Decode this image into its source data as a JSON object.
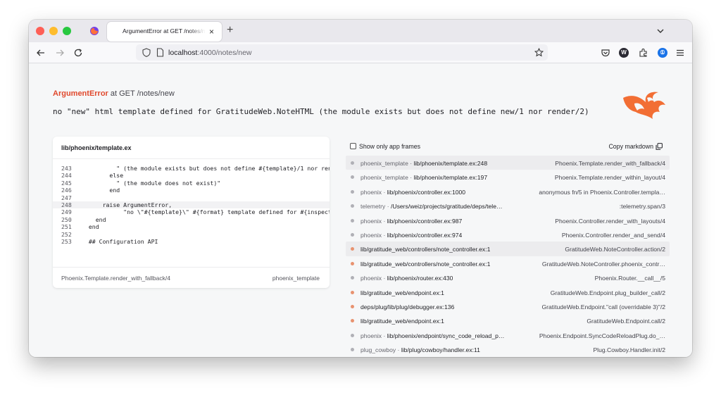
{
  "browser": {
    "tab_title": "ArgumentError at GET /notes/new",
    "tab_close": "×",
    "new_tab": "+",
    "url_host": "localhost",
    "url_path": ":4000/notes/new",
    "ext_w": "W",
    "ext_pw": "①"
  },
  "error": {
    "type": "ArgumentError",
    "location": " at GET /notes/new",
    "message": "no \"new\" html template defined for GratitudeWeb.NoteHTML  (the module exists but does not define new/1 nor render/2)"
  },
  "code_panel": {
    "file": "lib/phoenix/template.ex",
    "highlighted_line": 248,
    "lines": [
      {
        "num": "243",
        "code": "          \" (the module exists but does not define #{template}/1 nor render/2)\""
      },
      {
        "num": "244",
        "code": "        else"
      },
      {
        "num": "245",
        "code": "          \" (the module does not exist)\""
      },
      {
        "num": "246",
        "code": "        end"
      },
      {
        "num": "247",
        "code": ""
      },
      {
        "num": "248",
        "code": "      raise ArgumentError,"
      },
      {
        "num": "249",
        "code": "            \"no \\\"#{template}\\\" #{format} template defined for #{inspect(module)}\""
      },
      {
        "num": "250",
        "code": "    end"
      },
      {
        "num": "251",
        "code": "  end"
      },
      {
        "num": "252",
        "code": ""
      },
      {
        "num": "253",
        "code": "  ## Configuration API"
      }
    ],
    "footer_function": "Phoenix.Template.render_with_fallback/4",
    "footer_app": "phoenix_template"
  },
  "stacktrace": {
    "show_only_label": "Show only app frames",
    "copy_label": "Copy markdown",
    "frames": [
      {
        "app": "phoenix_template · ",
        "file": "lib/phoenix/template.ex:248",
        "fn": "Phoenix.Template.render_with_fallback/4",
        "kind": "lib",
        "active": true
      },
      {
        "app": "phoenix_template · ",
        "file": "lib/phoenix/template.ex:197",
        "fn": "Phoenix.Template.render_within_layout/4",
        "kind": "lib",
        "active": false
      },
      {
        "app": "phoenix · ",
        "file": "lib/phoenix/controller.ex:1000",
        "fn": "anonymous fn/5 in Phoenix.Controller.templa…",
        "kind": "lib",
        "active": false
      },
      {
        "app": "telemetry · ",
        "file": "/Users/weiz/projects/gratitude/deps/tele…",
        "fn": ":telemetry.span/3",
        "kind": "lib",
        "active": false
      },
      {
        "app": "phoenix · ",
        "file": "lib/phoenix/controller.ex:987",
        "fn": "Phoenix.Controller.render_with_layouts/4",
        "kind": "lib",
        "active": false
      },
      {
        "app": "phoenix · ",
        "file": "lib/phoenix/controller.ex:974",
        "fn": "Phoenix.Controller.render_and_send/4",
        "kind": "lib",
        "active": false
      },
      {
        "app": "",
        "file": "lib/gratitude_web/controllers/note_controller.ex:1",
        "fn": "GratitudeWeb.NoteController.action/2",
        "kind": "app",
        "active": true
      },
      {
        "app": "",
        "file": "lib/gratitude_web/controllers/note_controller.ex:1",
        "fn": "GratitudeWeb.NoteController.phoenix_contr…",
        "kind": "app",
        "active": false
      },
      {
        "app": "phoenix · ",
        "file": "lib/phoenix/router.ex:430",
        "fn": "Phoenix.Router.__call__/5",
        "kind": "lib",
        "active": false
      },
      {
        "app": "",
        "file": "lib/gratitude_web/endpoint.ex:1",
        "fn": "GratitudeWeb.Endpoint.plug_builder_call/2",
        "kind": "app",
        "active": false
      },
      {
        "app": "",
        "file": "deps/plug/lib/plug/debugger.ex:136",
        "fn": "GratitudeWeb.Endpoint.\"call (overridable 3)\"/2",
        "kind": "app",
        "active": false
      },
      {
        "app": "",
        "file": "lib/gratitude_web/endpoint.ex:1",
        "fn": "GratitudeWeb.Endpoint.call/2",
        "kind": "app",
        "active": false
      },
      {
        "app": "phoenix · ",
        "file": "lib/phoenix/endpoint/sync_code_reload_p…",
        "fn": "Phoenix.Endpoint.SyncCodeReloadPlug.do_…",
        "kind": "lib",
        "active": false
      },
      {
        "app": "plug_cowboy · ",
        "file": "lib/plug/cowboy/handler.ex:11",
        "fn": "Plug.Cowboy.Handler.init/2",
        "kind": "lib",
        "active": false
      }
    ]
  },
  "colors": {
    "accent": "#e0492d",
    "app_frame_dot": "#e8926f",
    "lib_frame_dot": "#b0b0b6"
  }
}
